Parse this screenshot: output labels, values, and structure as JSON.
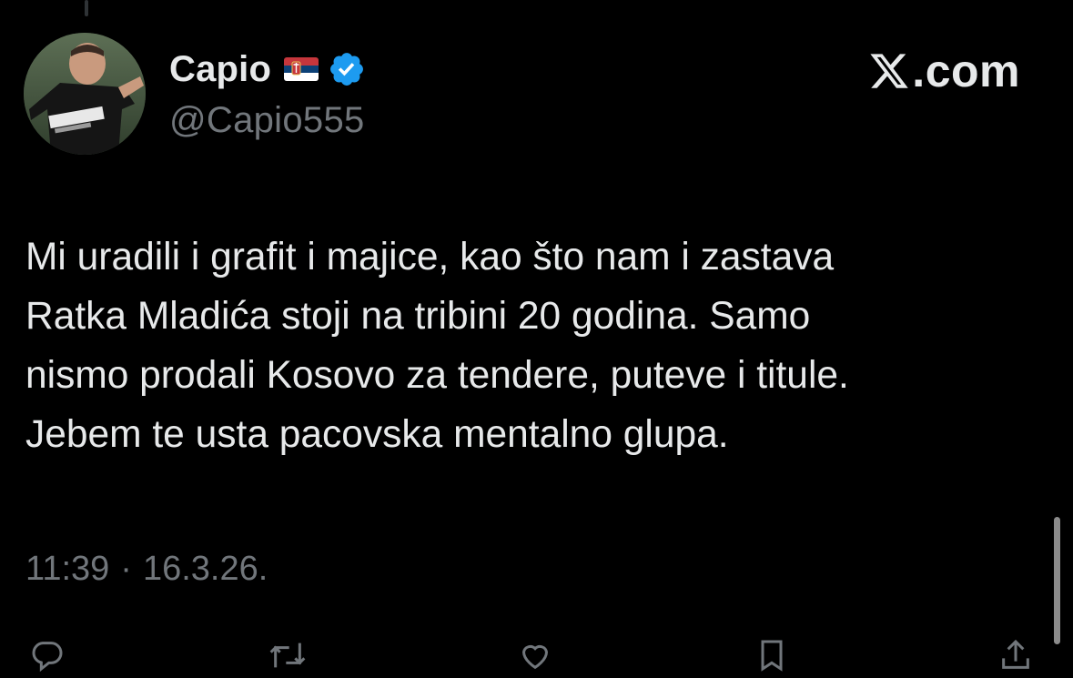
{
  "author": {
    "display_name": "Capio",
    "handle": "@Capio555",
    "flag_icon": "serbia-flag-icon",
    "verified_icon": "verified-badge-icon",
    "verified_color": "#1d9bf0"
  },
  "watermark": {
    "logo_icon": "x-logo-icon",
    "text": ".com"
  },
  "tweet": {
    "lines": [
      "Mi uradili i grafit i majice, kao što nam i zastava",
      "Ratka Mladića stoji na tribini 20 godina. Samo",
      "nismo prodali Kosovo za tendere, puteve i titule.",
      "Jebem te usta pacovska mentalno glupa."
    ]
  },
  "meta": {
    "time": "11:39",
    "separator": "·",
    "date": "16.3.26."
  },
  "actions": [
    {
      "icon": "reply-icon"
    },
    {
      "icon": "retweet-icon"
    },
    {
      "icon": "like-icon"
    },
    {
      "icon": "bookmark-icon"
    },
    {
      "icon": "share-icon"
    }
  ],
  "colors": {
    "background": "#000000",
    "primary_text": "#e7e9ea",
    "secondary_text": "#71767b",
    "accent": "#1d9bf0"
  }
}
